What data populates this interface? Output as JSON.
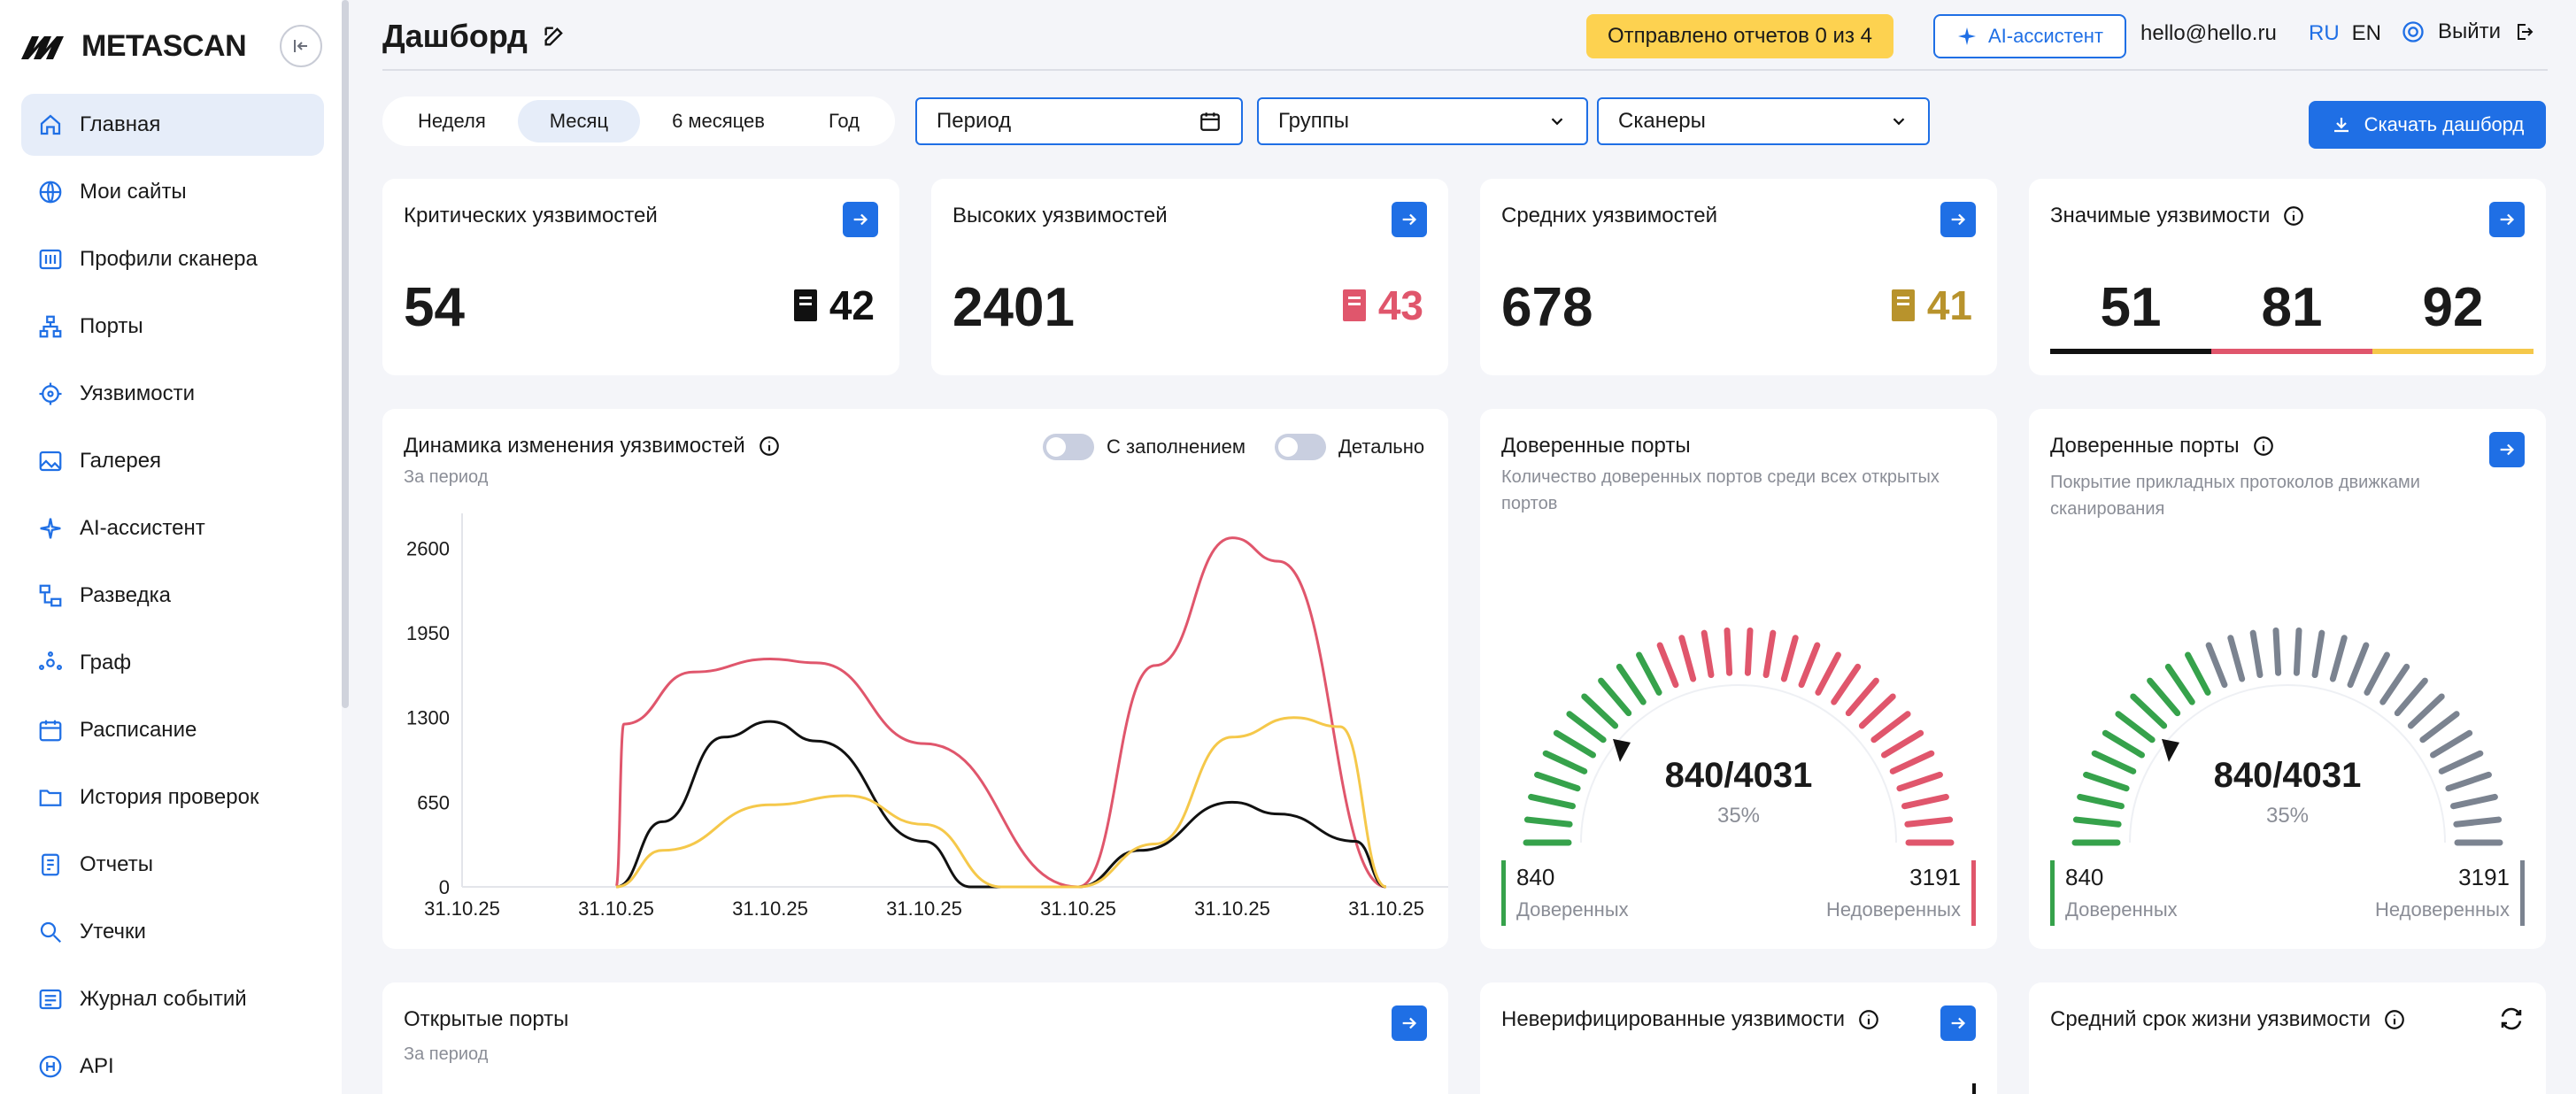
{
  "app": {
    "logo_text": "METASCAN"
  },
  "sidebar": {
    "items": [
      {
        "label": "Главная",
        "icon": "home-icon",
        "active": true
      },
      {
        "label": "Мои сайты",
        "icon": "globe-icon"
      },
      {
        "label": "Профили сканера",
        "icon": "sliders-icon"
      },
      {
        "label": "Порты",
        "icon": "network-icon"
      },
      {
        "label": "Уязвимости",
        "icon": "target-icon"
      },
      {
        "label": "Галерея",
        "icon": "image-icon"
      },
      {
        "label": "AI-ассистент",
        "icon": "sparkle-icon"
      },
      {
        "label": "Разведка",
        "icon": "recon-icon"
      },
      {
        "label": "Граф",
        "icon": "graph-icon"
      },
      {
        "label": "Расписание",
        "icon": "calendar-icon"
      },
      {
        "label": "История проверок",
        "icon": "folder-icon"
      },
      {
        "label": "Отчеты",
        "icon": "report-icon"
      },
      {
        "label": "Утечки",
        "icon": "search-icon"
      },
      {
        "label": "Журнал событий",
        "icon": "list-icon"
      },
      {
        "label": "API",
        "icon": "api-icon"
      }
    ]
  },
  "header": {
    "title": "Дашборд",
    "reports_badge": "Отправлено отчетов 0 из 4",
    "ai_button": "AI-ассистент",
    "email": "hello@hello.ru",
    "lang_ru": "RU",
    "lang_en": "EN",
    "logout": "Выйти"
  },
  "filters": {
    "periods": [
      "Неделя",
      "Месяц",
      "6 месяцев",
      "Год"
    ],
    "active_period": "Месяц",
    "period_input": "Период",
    "groups_select": "Группы",
    "scanners_select": "Сканеры",
    "download_button": "Скачать дашборд"
  },
  "cards": {
    "critical": {
      "title": "Критических уязвимостей",
      "value": "54",
      "side": "42",
      "color": "#111111"
    },
    "high": {
      "title": "Высоких уязвимостей",
      "value": "2401",
      "side": "43",
      "color": "#e0566c"
    },
    "medium": {
      "title": "Средних уязвимостей",
      "value": "678",
      "side": "41",
      "color": "#b8932c"
    },
    "significant": {
      "title": "Значимые уязвимости",
      "values": [
        "51",
        "81",
        "92"
      ],
      "colors": [
        "#111111",
        "#e0566c",
        "#f5c84a"
      ]
    }
  },
  "dynamics": {
    "title": "Динамика изменения уязвимостей",
    "subtitle": "За период",
    "toggle_fill": "С заполнением",
    "toggle_detail": "Детально"
  },
  "chart_data": {
    "type": "line",
    "x": [
      "31.10.25",
      "31.10.25",
      "31.10.25",
      "31.10.25",
      "31.10.25",
      "31.10.25",
      "31.10.25"
    ],
    "yticks": [
      "0",
      "650",
      "1300",
      "1950",
      "2600"
    ],
    "ylim": [
      0,
      2800
    ],
    "series": [
      {
        "color": "#e0566c",
        "points": [
          [
            1,
            0
          ],
          [
            1.05,
            1250
          ],
          [
            1.5,
            1650
          ],
          [
            2.0,
            1750
          ],
          [
            2.3,
            1720
          ],
          [
            3.0,
            1100
          ],
          [
            4.0,
            0
          ],
          [
            4.5,
            1700
          ],
          [
            5.0,
            2680
          ],
          [
            5.3,
            2500
          ],
          [
            6.0,
            0
          ]
        ]
      },
      {
        "color": "#111111",
        "points": [
          [
            1,
            0
          ],
          [
            1.3,
            500
          ],
          [
            1.7,
            1150
          ],
          [
            2.0,
            1270
          ],
          [
            2.3,
            1120
          ],
          [
            3.0,
            350
          ],
          [
            3.3,
            0
          ],
          [
            4.0,
            0
          ],
          [
            4.4,
            280
          ],
          [
            5.0,
            650
          ],
          [
            5.3,
            560
          ],
          [
            5.8,
            350
          ],
          [
            6.0,
            0
          ]
        ]
      },
      {
        "color": "#f5c84a",
        "points": [
          [
            1,
            0
          ],
          [
            1.3,
            280
          ],
          [
            2.0,
            630
          ],
          [
            2.5,
            700
          ],
          [
            3.0,
            480
          ],
          [
            3.5,
            0
          ],
          [
            4.0,
            0
          ],
          [
            4.5,
            330
          ],
          [
            5.0,
            1150
          ],
          [
            5.4,
            1300
          ],
          [
            5.7,
            1230
          ],
          [
            6.0,
            0
          ]
        ]
      }
    ]
  },
  "trusted_ports": {
    "title": "Доверенные порты",
    "subtitle": "Количество доверенных портов среди всех открытых портов",
    "value": "840/4031",
    "percent": "35%",
    "fraction": 0.35,
    "trusted_num": "840",
    "trusted_label": "Доверенных",
    "untrusted_num": "3191",
    "untrusted_label": "Недоверенных",
    "colors": {
      "ok": "#36a24b",
      "bad": "#e0566c"
    }
  },
  "trusted_ports2": {
    "title": "Доверенные порты",
    "subtitle": "Покрытие прикладных протоколов движками сканирования",
    "value": "840/4031",
    "percent": "35%",
    "fraction": 0.35,
    "trusted_num": "840",
    "trusted_label": "Доверенных",
    "untrusted_num": "3191",
    "untrusted_label": "Недоверенных",
    "colors": {
      "ok": "#36a24b",
      "bad": "#7b8390"
    }
  },
  "open_ports": {
    "title": "Открытые порты",
    "subtitle": "За период"
  },
  "unverified": {
    "title": "Неверифицированные уязвимости"
  },
  "lifetime": {
    "title": "Средний срок жизни уязвимости"
  }
}
